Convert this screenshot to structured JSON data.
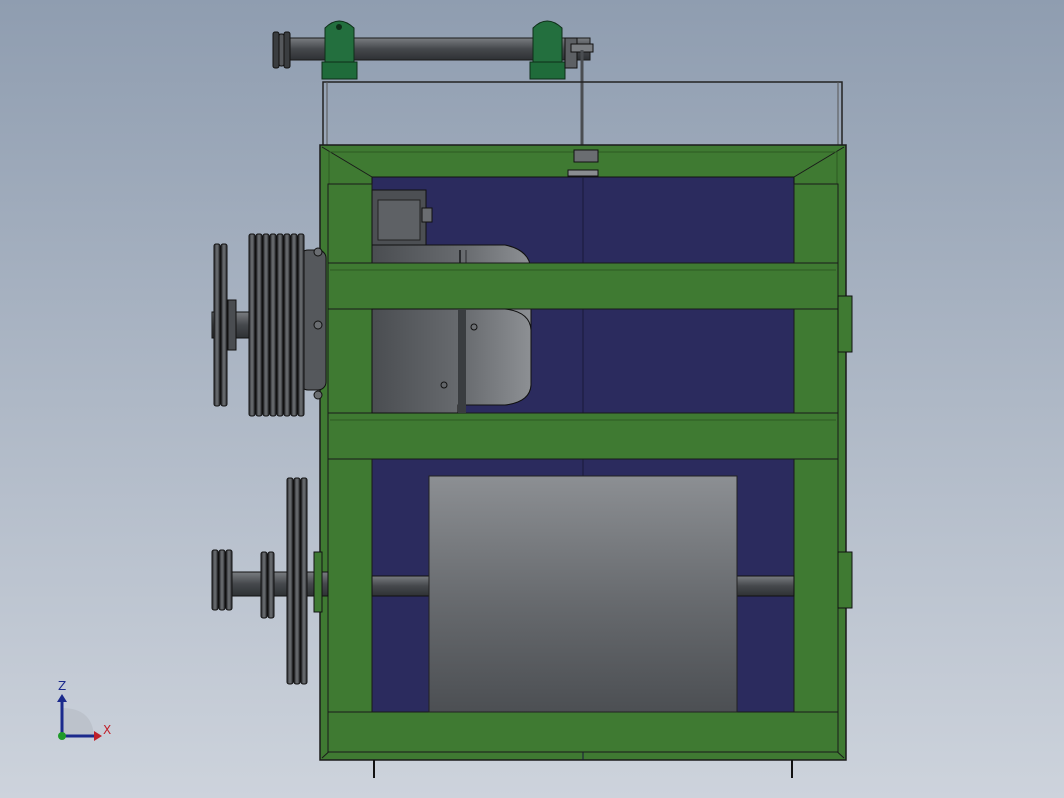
{
  "viewport": {
    "background_top": "#8f9db0",
    "background_bottom": "#cdd3dc"
  },
  "colors": {
    "frame_green": "#3f7a32",
    "frame_green_dark": "#2c5a22",
    "frame_green_light": "#4f8f3f",
    "panel_blue": "#2b2b5e",
    "metal_light": "#8a8d91",
    "metal_mid": "#5c5f63",
    "metal_dark": "#35383b",
    "bearing_green": "#1f6b3a",
    "outline": "#1a1a1a"
  },
  "triad": {
    "z_label": "Z",
    "x_label": "X",
    "z_color": "#1b2a8c",
    "x_color": "#c0202a",
    "y_color": "#1e9a2a"
  }
}
